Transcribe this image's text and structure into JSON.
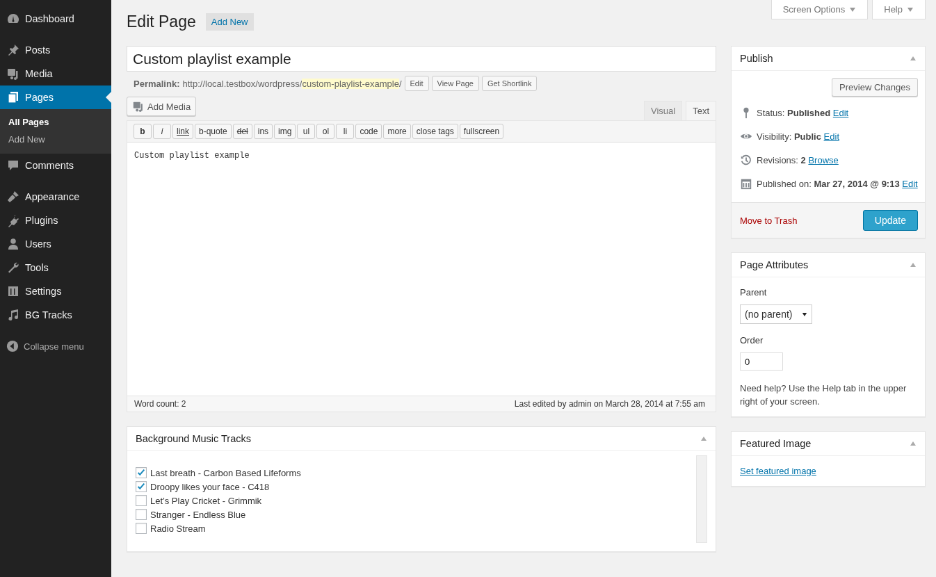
{
  "sidebar": {
    "items": [
      {
        "label": "Dashboard",
        "selected": false
      },
      {
        "label": "Posts",
        "selected": false
      },
      {
        "label": "Media",
        "selected": false
      },
      {
        "label": "Pages",
        "selected": true,
        "children": [
          {
            "label": "All Pages",
            "selected": true
          },
          {
            "label": "Add New",
            "selected": false
          }
        ]
      },
      {
        "label": "Comments",
        "selected": false
      },
      {
        "label": "Appearance",
        "selected": false
      },
      {
        "label": "Plugins",
        "selected": false
      },
      {
        "label": "Users",
        "selected": false
      },
      {
        "label": "Tools",
        "selected": false
      },
      {
        "label": "Settings",
        "selected": false
      },
      {
        "label": "BG Tracks",
        "selected": false
      }
    ],
    "collapse": "Collapse menu"
  },
  "screen_meta": [
    "Screen Options",
    "Help"
  ],
  "heading": {
    "title": "Edit Page",
    "add_new": "Add New"
  },
  "title_field": {
    "value": "Custom playlist example"
  },
  "permalink": {
    "label": "Permalink:",
    "base": "http://local.testbox/wordpress/",
    "slug": "custom-playlist-example",
    "trail": "/",
    "buttons": [
      "Edit",
      "View Page",
      "Get Shortlink"
    ]
  },
  "add_media": "Add Media",
  "editor_tabs": [
    {
      "label": "Visual",
      "selected": false
    },
    {
      "label": "Text",
      "selected": true
    }
  ],
  "quicktags": [
    {
      "label": "b",
      "kind": "bold"
    },
    {
      "label": "i",
      "kind": "italic"
    },
    {
      "label": "link",
      "kind": "link"
    },
    {
      "label": "b-quote",
      "kind": "plain"
    },
    {
      "label": "del",
      "kind": "strike"
    },
    {
      "label": "ins",
      "kind": "plain"
    },
    {
      "label": "img",
      "kind": "plain"
    },
    {
      "label": "ul",
      "kind": "plain"
    },
    {
      "label": "ol",
      "kind": "plain"
    },
    {
      "label": "li",
      "kind": "plain"
    },
    {
      "label": "code",
      "kind": "plain"
    },
    {
      "label": "more",
      "kind": "plain"
    },
    {
      "label": "close tags",
      "kind": "plain"
    },
    {
      "label": "fullscreen",
      "kind": "plain"
    }
  ],
  "content": "Custom playlist example",
  "status": {
    "word_count": "Word count: 2",
    "last_edited": "Last edited by admin on March 28, 2014 at 7:55 am"
  },
  "tracks": {
    "title": "Background Music Tracks",
    "items": [
      {
        "label": "Last breath - Carbon Based Lifeforms",
        "checked": true
      },
      {
        "label": "Droopy likes your face - C418",
        "checked": true
      },
      {
        "label": "Let’s Play Cricket - Grimmik",
        "checked": false
      },
      {
        "label": "Stranger - Endless Blue",
        "checked": false
      },
      {
        "label": "Radio Stream",
        "checked": false
      }
    ]
  },
  "publish": {
    "title": "Publish",
    "preview": "Preview Changes",
    "rows": [
      {
        "text": "Status: **Published**",
        "link": "Edit"
      },
      {
        "text": "Visibility: **Public**",
        "link": "Edit"
      },
      {
        "text": "Revisions: **2**",
        "link": "Browse"
      },
      {
        "text": "Published on: **Mar 27, 2014 @ 9:13**",
        "link": "Edit"
      }
    ],
    "trash": "Move to Trash",
    "update": "Update"
  },
  "page_attributes": {
    "title": "Page Attributes",
    "parent_label": "Parent",
    "parent_value": "(no parent)",
    "order_label": "Order",
    "order_value": "0",
    "help": "Need help? Use the Help tab in the upper right of your screen."
  },
  "featured": {
    "title": "Featured Image",
    "link": "Set featured image"
  }
}
